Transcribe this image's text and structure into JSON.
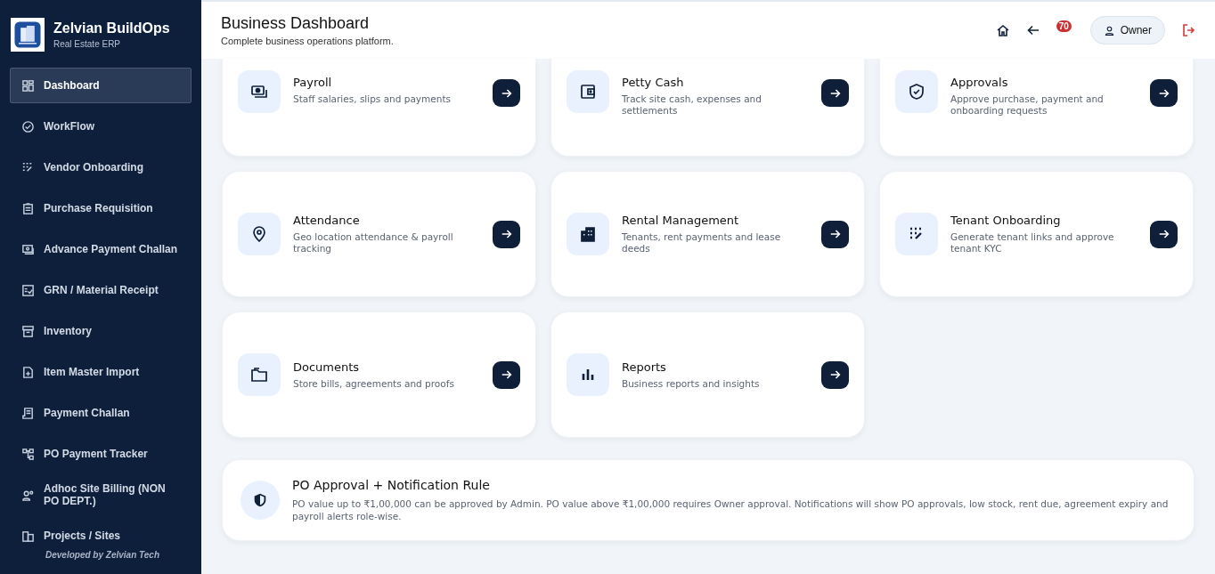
{
  "sidebar": {
    "brand": "Zelvian BuildOps",
    "subtitle": "Real Estate ERP",
    "items": [
      {
        "label": "Dashboard",
        "selected": true
      },
      {
        "label": "WorkFlow",
        "selected": false
      },
      {
        "label": "Vendor Onboarding",
        "selected": false
      },
      {
        "label": "Purchase Requisition",
        "selected": false
      },
      {
        "label": "Advance Payment Challan",
        "selected": false
      },
      {
        "label": "GRN / Material Receipt",
        "selected": false
      },
      {
        "label": "Inventory",
        "selected": false
      },
      {
        "label": "Item Master Import",
        "selected": false
      },
      {
        "label": "Payment Challan",
        "selected": false
      },
      {
        "label": "PO Payment Tracker",
        "selected": false
      },
      {
        "label": "Adhoc Site Billing (NON PO DEPT.)",
        "selected": false
      },
      {
        "label": "Projects / Sites",
        "selected": false
      }
    ],
    "footer": "Developed by Zelvian Tech"
  },
  "header": {
    "title": "Business Dashboard",
    "subtitle": "Complete business operations platform.",
    "notifications": "70",
    "user": "Owner"
  },
  "cards": [
    {
      "title": "Payroll",
      "description": "Staff salaries, slips and payments"
    },
    {
      "title": "Petty Cash",
      "description": "Track site cash, expenses and settlements"
    },
    {
      "title": "Approvals",
      "description": "Approve purchase, payment and onboarding requests"
    },
    {
      "title": "Attendance",
      "description": "Geo location attendance & payroll tracking"
    },
    {
      "title": "Rental Management",
      "description": "Tenants, rent payments and lease deeds"
    },
    {
      "title": "Tenant Onboarding",
      "description": "Generate tenant links and approve tenant KYC"
    },
    {
      "title": "Documents",
      "description": "Store bills, agreements and proofs"
    },
    {
      "title": "Reports",
      "description": "Business reports and insights"
    }
  ],
  "rule": {
    "title": "PO Approval + Notification Rule",
    "text": "PO value up to ₹1,00,000 can be approved by Admin. PO value above ₹1,00,000 requires Owner approval. Notifications will show PO approvals, low stock, rent due, agreement expiry and payroll alerts role-wise."
  }
}
